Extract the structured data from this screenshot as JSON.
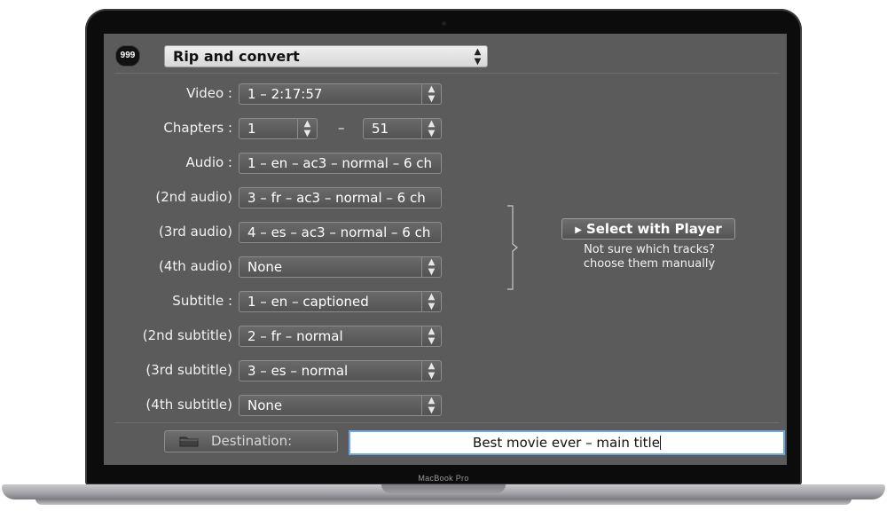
{
  "device": {
    "brand": "MacBook Pro"
  },
  "app": {
    "logo_text": "999",
    "mode": {
      "selected": "Rip and convert"
    },
    "fields": [
      {
        "label": "Video :",
        "value": "1 – 2:17:57",
        "has_arrow": true
      },
      {
        "label": "Chapters :",
        "start": "1",
        "separator": "–",
        "end": "51"
      },
      {
        "label": "Audio :",
        "value": "1 – en – ac3 – normal – 6 ch",
        "has_arrow": false
      },
      {
        "label": "(2nd audio)",
        "value": "3 – fr – ac3 – normal – 6 ch",
        "has_arrow": false
      },
      {
        "label": "(3rd audio)",
        "value": "4 – es – ac3 – normal – 6 ch",
        "has_arrow": false
      },
      {
        "label": "(4th audio)",
        "value": "None",
        "has_arrow": true
      },
      {
        "label": "Subtitle :",
        "value": "1 – en – captioned",
        "has_arrow": true
      },
      {
        "label": "(2nd subtitle)",
        "value": "2 – fr – normal",
        "has_arrow": true
      },
      {
        "label": "(3rd subtitle)",
        "value": "3 – es – normal",
        "has_arrow": true
      },
      {
        "label": "(4th subtitle)",
        "value": "None",
        "has_arrow": true
      }
    ],
    "player": {
      "button_label": "Select with Player",
      "hint_line1": "Not sure which tracks?",
      "hint_line2": "choose them manually"
    },
    "destination": {
      "button_label": "Destination:",
      "value": "Best movie ever – main title"
    },
    "icons": {
      "logo": "app-logo-icon",
      "arrows": "up-down-chevron-icon",
      "play": "play-triangle-icon",
      "folder": "folder-icon"
    },
    "colors": {
      "panel": "#5b5b5b",
      "field_focus": "#6aa7e6"
    }
  }
}
